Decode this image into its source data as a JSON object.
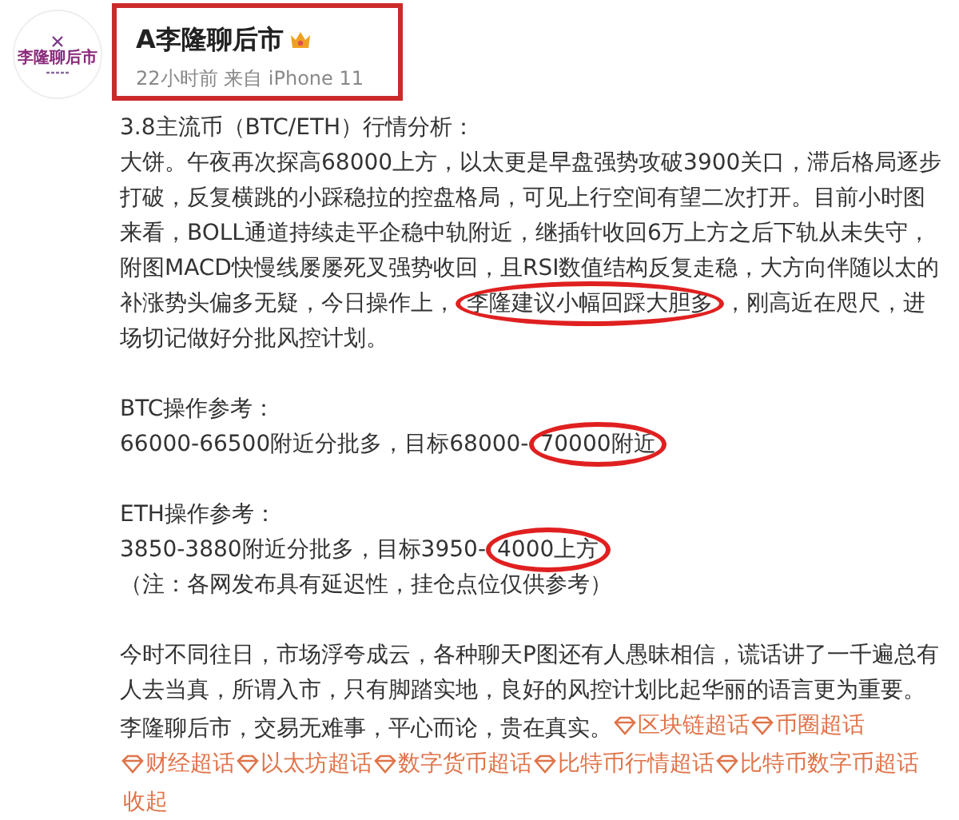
{
  "account": {
    "avatar_text": "李隆聊后市",
    "name": "A李隆聊后市",
    "meta": "22小时前 来自 iPhone 11",
    "highlighted": true
  },
  "sections": [
    [
      [
        {
          "kind": "text",
          "text": "3.8主流币（BTC/ETH）行情分析："
        }
      ],
      [
        {
          "kind": "text",
          "text": "大饼。午夜再次探高68000上方，以太更是早盘强势攻破3900关口，滞后格局逐步打破，反复横跳的小踩稳拉的控盘格局，可见上行空间有望二次打开。目前小时图来看，BOLL通道持续走平企稳中轨附近，继插针收回6万上方之后下轨从未失守，附图MACD快慢线屡屡死叉强势收回，且RSI数值结构反复走稳，大方向伴随以太的补涨势头偏多无疑，今日操作上，"
        },
        {
          "kind": "text",
          "text": "李隆建议小幅回踩大胆多",
          "circled": true
        },
        {
          "kind": "text",
          "text": "，刚高近在咫尺，进场切记做好分批风控计划。"
        }
      ]
    ],
    [
      [
        {
          "kind": "text",
          "text": "BTC操作参考："
        }
      ],
      [
        {
          "kind": "text",
          "text": "66000-66500附近分批多，目标68000-"
        },
        {
          "kind": "text",
          "text": "70000附近",
          "circled": true
        }
      ]
    ],
    [
      [
        {
          "kind": "text",
          "text": "ETH操作参考："
        }
      ],
      [
        {
          "kind": "text",
          "text": "3850-3880附近分批多，目标3950-"
        },
        {
          "kind": "text",
          "text": "4000上方",
          "circled": true
        }
      ],
      [
        {
          "kind": "text",
          "text": "（注：各网发布具有延迟性，挂仓点位仅供参考）"
        }
      ]
    ],
    [
      [
        {
          "kind": "text",
          "text": "今时不同往日，市场浮夸成云，各种聊天P图还有人愚昧相信，谎话讲了一千遍总有人去当真，所谓入市，只有脚踏实地，良好的风控计划比起华丽的语言更为重要。李隆聊后市，交易无难事，平心而论，贵在真实。"
        },
        {
          "kind": "topic",
          "text": "区块链超话"
        },
        {
          "kind": "topic",
          "text": "币圈超话"
        },
        {
          "kind": "topic",
          "text": "财经超话"
        },
        {
          "kind": "topic",
          "text": "以太坊超话"
        },
        {
          "kind": "topic",
          "text": "数字货币超话"
        },
        {
          "kind": "topic",
          "text": "比特币行情超话"
        },
        {
          "kind": "topic",
          "text": "比特币数字币超话"
        }
      ],
      [
        {
          "kind": "collapse",
          "text": "收起"
        }
      ]
    ]
  ]
}
